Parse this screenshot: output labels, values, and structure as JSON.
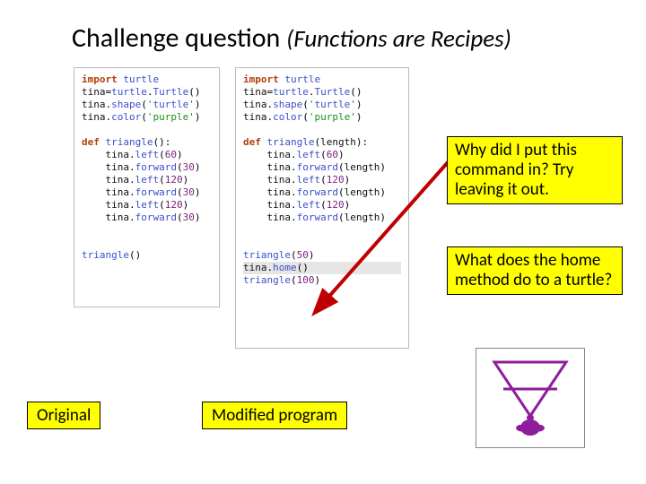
{
  "title": {
    "main": "Challenge question",
    "sub": "(Functions are Recipes)"
  },
  "code_original": "import turtle\ntina=turtle.Turtle()\ntina.shape('turtle')\ntina.color('purple')\n\ndef triangle():\n    tina.left(60)\n    tina.forward(30)\n    tina.left(120)\n    tina.forward(30)\n    tina.left(120)\n    tina.forward(30)\n\n\ntriangle()",
  "code_modified": "import turtle\ntina=turtle.Turtle()\ntina.shape('turtle')\ntina.color('purple')\n\ndef triangle(length):\n    tina.left(60)\n    tina.forward(length)\n    tina.left(120)\n    tina.forward(length)\n    tina.left(120)\n    tina.forward(length)\n\n\ntriangle(50)\ntina.home()\ntriangle(100)",
  "notes": {
    "note1": "Why did I put this command in? Try leaving it out.",
    "note2": "What does the home method do to a turtle?"
  },
  "labels": {
    "original": "Original",
    "modified": "Modified program"
  }
}
